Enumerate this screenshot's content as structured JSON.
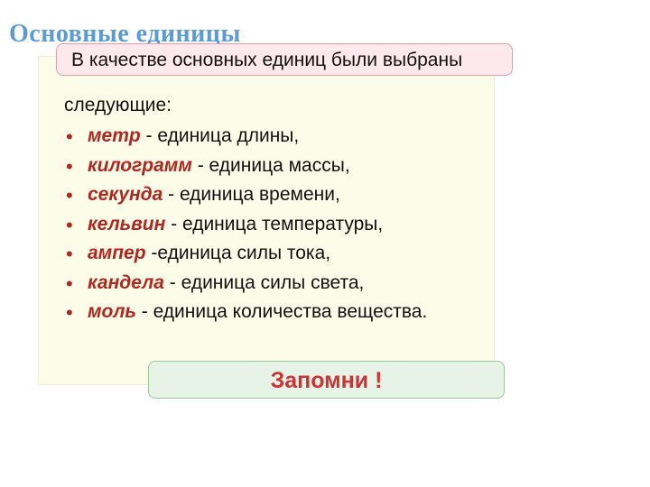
{
  "title": "Основные  единицы",
  "intro_overlay": "В качестве основных единиц были выбраны",
  "intro_rest": "следующие:",
  "units": [
    {
      "name": "метр",
      "desc": " - единица длины,"
    },
    {
      "name": "килограмм",
      "desc": " - единица массы,"
    },
    {
      "name": "секунда",
      "desc": " - единица времени,"
    },
    {
      "name": "кельвин",
      "desc": " - единица температуры,"
    },
    {
      "name": "ампер",
      "desc": " -единица силы тока,"
    },
    {
      "name": "кандела",
      "desc": " - единица силы света,"
    },
    {
      "name": "моль",
      "desc": " - единица количества вещества."
    }
  ],
  "remember": "Запомни !"
}
